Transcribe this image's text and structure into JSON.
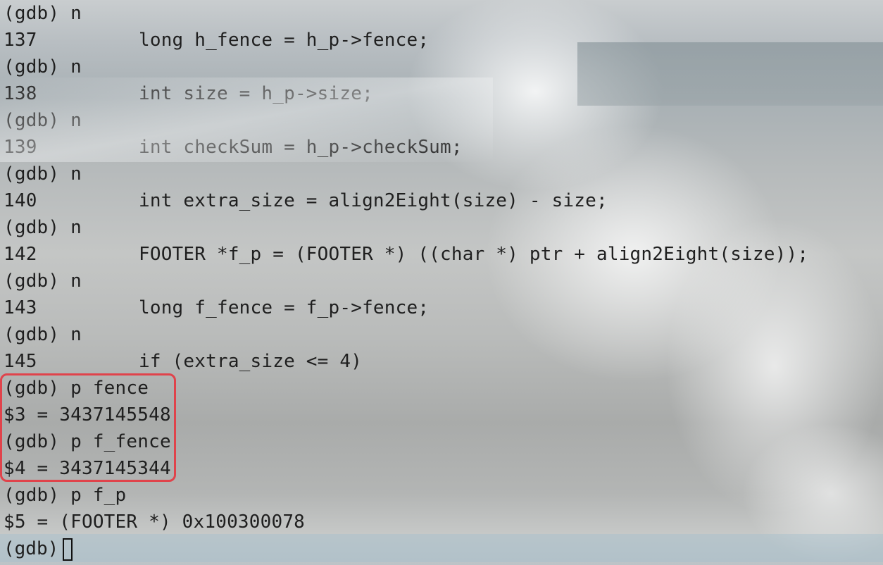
{
  "terminal": {
    "lines": [
      {
        "kind": "prompt",
        "text": "(gdb) n"
      },
      {
        "kind": "source",
        "num": "137",
        "code": "long h_fence = h_p->fence;"
      },
      {
        "kind": "prompt",
        "text": "(gdb) n"
      },
      {
        "kind": "source",
        "num": "138",
        "code": "int size = h_p->size;"
      },
      {
        "kind": "prompt",
        "text": "(gdb) n"
      },
      {
        "kind": "source",
        "num": "139",
        "code": "int checkSum = h_p->checkSum;"
      },
      {
        "kind": "prompt",
        "text": "(gdb) n"
      },
      {
        "kind": "source",
        "num": "140",
        "code": "int extra_size = align2Eight(size) - size;"
      },
      {
        "kind": "prompt",
        "text": "(gdb) n"
      },
      {
        "kind": "source",
        "num": "142",
        "code": "FOOTER *f_p = (FOOTER *) ((char *) ptr + align2Eight(size));"
      },
      {
        "kind": "prompt",
        "text": "(gdb) n"
      },
      {
        "kind": "source",
        "num": "143",
        "code": "long f_fence = f_p->fence;"
      },
      {
        "kind": "prompt",
        "text": "(gdb) n"
      },
      {
        "kind": "source",
        "num": "145",
        "code": "if (extra_size <= 4)"
      },
      {
        "kind": "prompt",
        "text": "(gdb) p fence"
      },
      {
        "kind": "output",
        "text": "$3 = 3437145548"
      },
      {
        "kind": "prompt",
        "text": "(gdb) p f_fence"
      },
      {
        "kind": "output",
        "text": "$4 = 3437145344"
      },
      {
        "kind": "prompt",
        "text": "(gdb) p f_p"
      },
      {
        "kind": "output",
        "text": "$5 = (FOOTER *) 0x100300078"
      }
    ],
    "current_prompt": "(gdb)",
    "highlight_color": "#e0434b"
  }
}
